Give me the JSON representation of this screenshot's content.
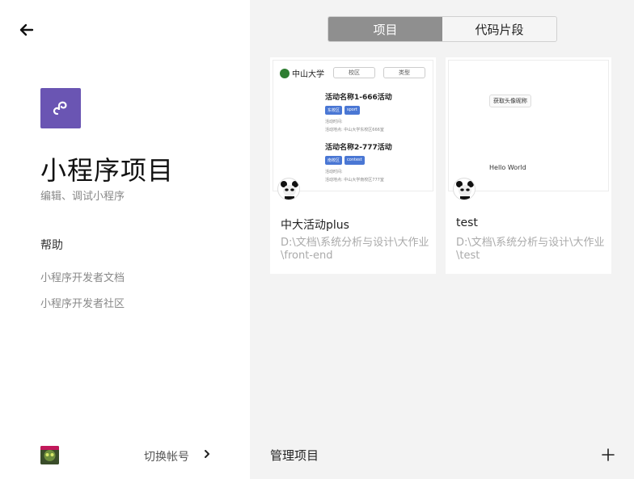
{
  "left": {
    "title": "小程序项目",
    "subtitle": "编辑、调试小程序",
    "help_heading": "帮助",
    "links": [
      "小程序开发者文档",
      "小程序开发者社区"
    ],
    "switch_account": "切换帐号"
  },
  "tabs": [
    {
      "label": "项目",
      "active": true
    },
    {
      "label": "代码片段",
      "active": false
    }
  ],
  "projects": [
    {
      "name": "中大活动plus",
      "path": "D:\\文档\\系统分析与设计\\大作业\\front-end",
      "thumb": {
        "brand": "中山大学",
        "buttons": [
          "校区",
          "类型"
        ],
        "items": [
          {
            "title": "活动名称1-666活动",
            "tags": [
              "东校区",
              "sport"
            ],
            "time": "活动时间:",
            "place": "活动地点:  中山大学东校区666室"
          },
          {
            "title": "活动名称2-777活动",
            "tags": [
              "南校区",
              "contest"
            ],
            "time": "活动时间:",
            "place": "活动地点:  中山大学南校区777室"
          }
        ]
      }
    },
    {
      "name": "test",
      "path": "D:\\文档\\系统分析与设计\\大作业\\test",
      "thumb": {
        "button": "获取头像昵称",
        "hello": "Hello World"
      }
    }
  ],
  "footer": {
    "manage": "管理项目"
  },
  "colors": {
    "logo_bg": "#6a55b3",
    "tab_active": "#8f8f8f",
    "tag_bg": "#4a77d4"
  }
}
